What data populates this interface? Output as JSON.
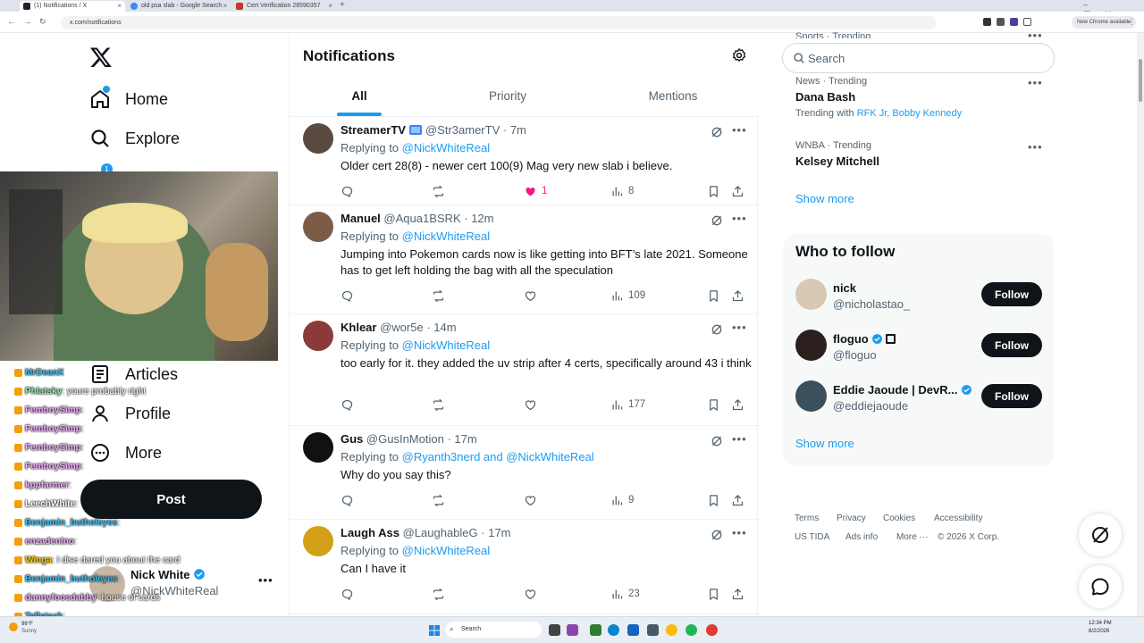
{
  "browser": {
    "tabs": [
      "(1) Notifications / X",
      "old psa slab - Google Search",
      "Cert Verification 28590357"
    ],
    "url": "x.com/notifications",
    "update_label": "New Chrome available"
  },
  "nav": {
    "home": "Home",
    "explore": "Explore",
    "articles": "Articles",
    "profile": "Profile",
    "more": "More",
    "post": "Post",
    "badge": "1",
    "account_name": "Nick White",
    "account_handle": "@NickWhiteReal"
  },
  "chat": [
    {
      "user": "MrDeanX",
      "msg": "",
      "color": "#38bdf8"
    },
    {
      "user": "Phlatsky",
      "msg": ": youre probably right",
      "color": "#86efac"
    },
    {
      "user": "FemboySimp",
      "msg": ":",
      "color": "#f0abfc"
    },
    {
      "user": "FemboySimp",
      "msg": ":",
      "color": "#f0abfc"
    },
    {
      "user": "FemboySimp",
      "msg": ":",
      "color": "#f0abfc"
    },
    {
      "user": "FemboySimp",
      "msg": ":",
      "color": "#f0abfc"
    },
    {
      "user": "kppfarmer",
      "msg": ":",
      "color": "#f0abfc"
    },
    {
      "user": "LeechWhite",
      "msg": ":",
      "color": "#ffffff"
    },
    {
      "user": "Benjamin_butholeyes",
      "msg": ":",
      "color": "#38bdf8"
    },
    {
      "user": "enzadenino",
      "msg": ":",
      "color": "#f0abfc"
    },
    {
      "user": "Winga",
      "msg": ": I dise dared you about the card",
      "color": "#facc15"
    },
    {
      "user": "Benjamin_butholeyes",
      "msg": ":",
      "color": "#38bdf8"
    },
    {
      "user": "dannyfoosdabby",
      "msg": ": house of cards",
      "color": "#f0abfc"
    },
    {
      "user": "Tallstack",
      "msg": ":",
      "color": "#38bdf8"
    }
  ],
  "main": {
    "title": "Notifications",
    "tabs": [
      "All",
      "Priority",
      "Mentions"
    ]
  },
  "tweets": [
    {
      "name": "StreamerTV",
      "handle": "@Str3amerTV",
      "time": "7m",
      "reply_prefix": "Replying to",
      "reply_to": "@NickWhiteReal",
      "body": "Older cert 28(8) - newer cert 100(9) Mag very new slab i believe.",
      "likes": "1",
      "views": "8",
      "liked": true,
      "avatar_color": "#5b4a3f"
    },
    {
      "name": "Manuel",
      "handle": "@Aqua1BSRK",
      "time": "12m",
      "reply_prefix": "Replying to",
      "reply_to": "@NickWhiteReal",
      "body": "Jumping into Pokemon cards now is like getting into BFT’s late 2021. Someone has to get left holding the bag with all the speculation",
      "likes": "",
      "views": "109",
      "liked": false,
      "avatar_color": "#7c5c46"
    },
    {
      "name": "Khlear",
      "handle": "@wor5e",
      "time": "14m",
      "reply_prefix": "Replying to",
      "reply_to": "@NickWhiteReal",
      "body": "too early for it. they added the uv strip after 4 certs, specifically around 43 i think",
      "likes": "",
      "views": "177",
      "liked": false,
      "avatar_color": "#8b3a3a"
    },
    {
      "name": "Gus",
      "handle": "@GusInMotion",
      "time": "17m",
      "reply_prefix": "Replying to",
      "reply_to": "@Ryanth3nerd and @NickWhiteReal",
      "body": "Why do you say this?",
      "likes": "",
      "views": "9",
      "liked": false,
      "avatar_color": "#111111"
    },
    {
      "name": "Laugh Ass",
      "handle": "@LaughableG",
      "time": "17m",
      "reply_prefix": "Replying to",
      "reply_to": "@NickWhiteReal",
      "body": "Can I have it",
      "likes": "",
      "views": "23",
      "liked": false,
      "avatar_color": "#d4a017"
    }
  ],
  "sidebar": {
    "search_placeholder": "Search",
    "trends_top": "Sports · Trending",
    "trends": [
      {
        "meta": "News · Trending",
        "name": "Dana Bash",
        "with_label": "Trending with",
        "with_links": "RFK Jr, Bobby Kennedy"
      },
      {
        "meta": "WNBA · Trending",
        "name": "Kelsey Mitchell"
      }
    ],
    "show_more": "Show more",
    "who_to_follow": "Who to follow",
    "follow": [
      {
        "name": "nick",
        "handle": "@nicholastao_",
        "button": "Follow",
        "verified": false,
        "avatar_color": "#d7c9b3"
      },
      {
        "name": "floguo",
        "handle": "@floguo",
        "button": "Follow",
        "verified": true,
        "avatar_color": "#2a1f1c"
      },
      {
        "name": "Eddie Jaoude | DevR...",
        "handle": "@eddiejaoude",
        "button": "Follow",
        "verified": true,
        "avatar_color": "#3b4f5c"
      }
    ],
    "show_more_2": "Show more",
    "footer": [
      "Terms",
      "Privacy",
      "Cookies",
      "Accessibility",
      "US TIDA",
      "Ads info",
      "More ···",
      "© 2026 X Corp."
    ]
  },
  "taskbar": {
    "search": "Search",
    "time": "12:34 PM",
    "date": "8/2/2026",
    "weather_temp": "96°F",
    "weather_desc": "Sunny"
  },
  "colors": {
    "accent": "#1d9bf0",
    "like": "#f91880",
    "text": "#0f1419",
    "muted": "#536471"
  }
}
